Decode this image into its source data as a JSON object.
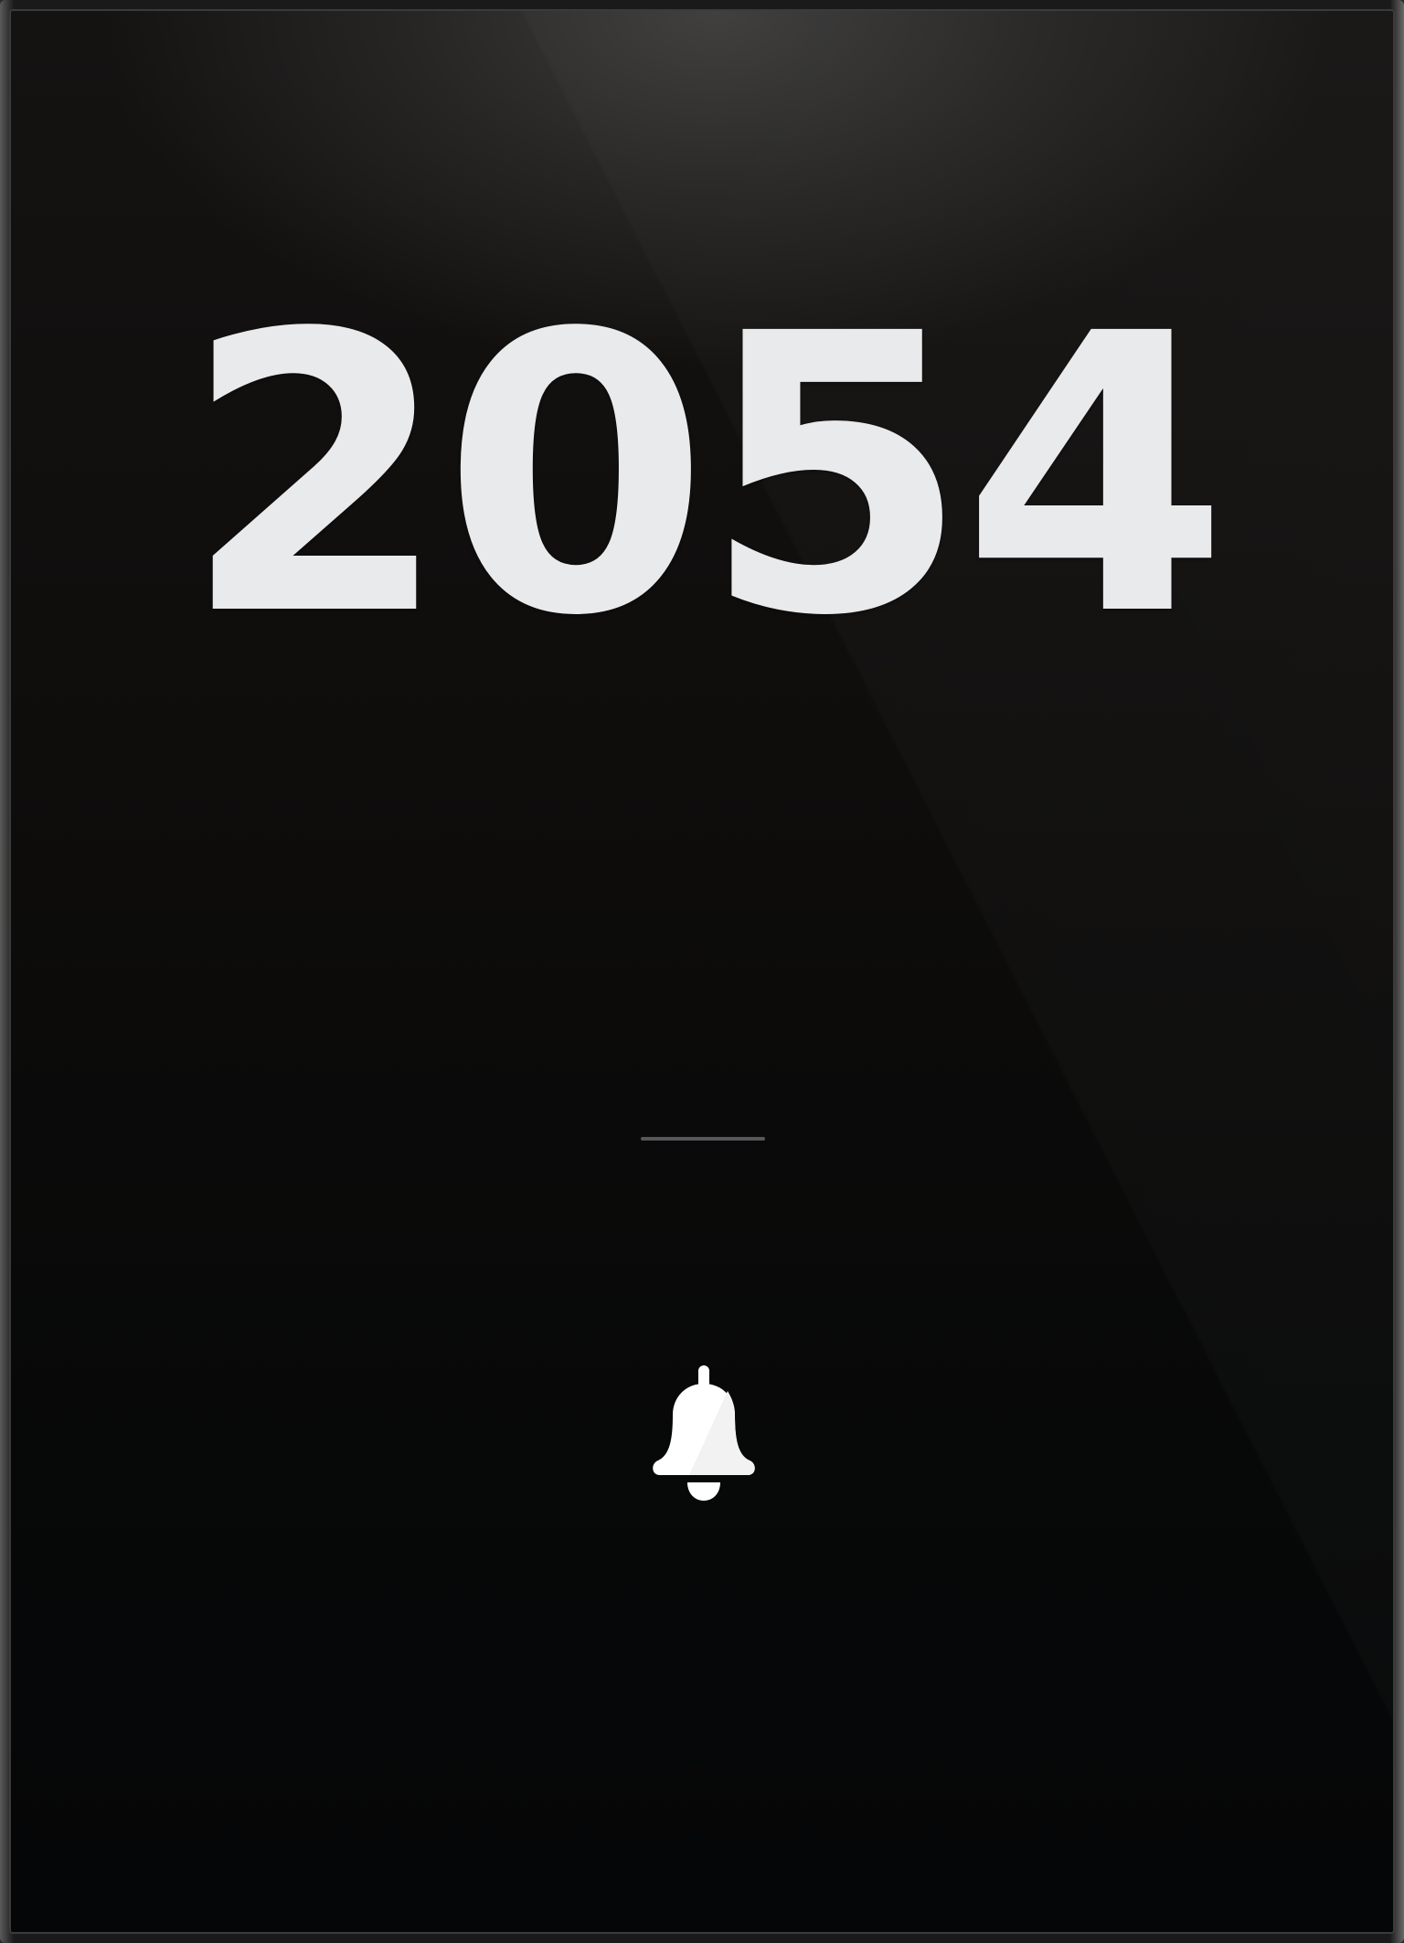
{
  "display": {
    "value": "2054"
  },
  "controls": {
    "bell_icon": "bell-icon"
  },
  "colors": {
    "value_text": "#e9eaec",
    "divider": "#56575a",
    "background": "#0d0c0b",
    "icon": "#ffffff"
  }
}
